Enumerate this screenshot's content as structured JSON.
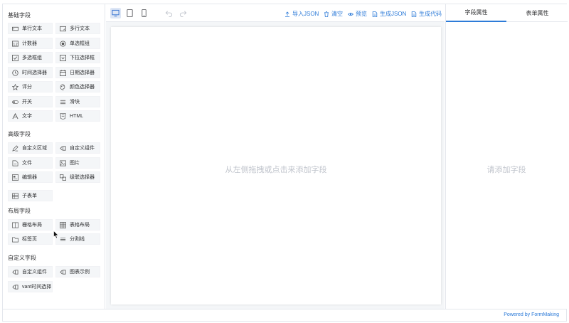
{
  "left_panel": {
    "groups": [
      {
        "title": "基础字段",
        "items": [
          {
            "label": "单行文本",
            "icon": "input-icon"
          },
          {
            "label": "多行文本",
            "icon": "textarea-icon"
          },
          {
            "label": "计数器",
            "icon": "counter-icon"
          },
          {
            "label": "单选框组",
            "icon": "radio-icon"
          },
          {
            "label": "多选框组",
            "icon": "checkbox-icon"
          },
          {
            "label": "下拉选择框",
            "icon": "select-icon"
          },
          {
            "label": "时间选择器",
            "icon": "clock-icon"
          },
          {
            "label": "日期选择器",
            "icon": "calendar-icon"
          },
          {
            "label": "评分",
            "icon": "star-icon"
          },
          {
            "label": "颜色选择器",
            "icon": "palette-icon"
          },
          {
            "label": "开关",
            "icon": "switch-icon"
          },
          {
            "label": "滑块",
            "icon": "slider-icon"
          },
          {
            "label": "文字",
            "icon": "text-icon"
          },
          {
            "label": "HTML",
            "icon": "html-icon"
          }
        ]
      },
      {
        "title": "高级字段",
        "items": [
          {
            "label": "自定义区域",
            "icon": "custom-area-icon"
          },
          {
            "label": "自定义组件",
            "icon": "component-icon"
          },
          {
            "label": "文件",
            "icon": "file-icon"
          },
          {
            "label": "图片",
            "icon": "image-icon"
          },
          {
            "label": "编辑器",
            "icon": "editor-icon"
          },
          {
            "label": "级联选择器",
            "icon": "cascader-icon"
          },
          {
            "label": "子表单",
            "icon": "subform-icon"
          }
        ]
      },
      {
        "title": "布局字段",
        "items": [
          {
            "label": "栅格布局",
            "icon": "grid-icon"
          },
          {
            "label": "表格布局",
            "icon": "table-icon"
          },
          {
            "label": "标签页",
            "icon": "tabs-icon"
          },
          {
            "label": "分割线",
            "icon": "divider-icon"
          }
        ]
      },
      {
        "title": "自定义字段",
        "items": [
          {
            "label": "自定义组件",
            "icon": "component-icon"
          },
          {
            "label": "图表示例",
            "icon": "component-icon"
          },
          {
            "label": "vant时间选择",
            "icon": "component-icon"
          }
        ]
      }
    ]
  },
  "toolbar": {
    "devices": [
      {
        "name": "pc-icon",
        "active": true
      },
      {
        "name": "tablet-icon",
        "active": false
      },
      {
        "name": "mobile-icon",
        "active": false
      }
    ],
    "actions": [
      {
        "label": "导入JSON",
        "icon": "upload-icon"
      },
      {
        "label": "清空",
        "icon": "trash-icon"
      },
      {
        "label": "预览",
        "icon": "eye-icon"
      },
      {
        "label": "生成JSON",
        "icon": "document-icon"
      },
      {
        "label": "生成代码",
        "icon": "document-icon"
      }
    ]
  },
  "canvas": {
    "empty_text": "从左侧拖拽或点击来添加字段"
  },
  "right_panel": {
    "tabs": [
      {
        "label": "字段属性",
        "active": true
      },
      {
        "label": "表单属性",
        "active": false
      }
    ],
    "empty_text": "请添加字段"
  },
  "footer": {
    "text": "Powered by FormMaking"
  },
  "colors": {
    "accent": "#2d7bd8",
    "item_bg": "#f4f6f8",
    "placeholder": "#c0c4cc"
  }
}
